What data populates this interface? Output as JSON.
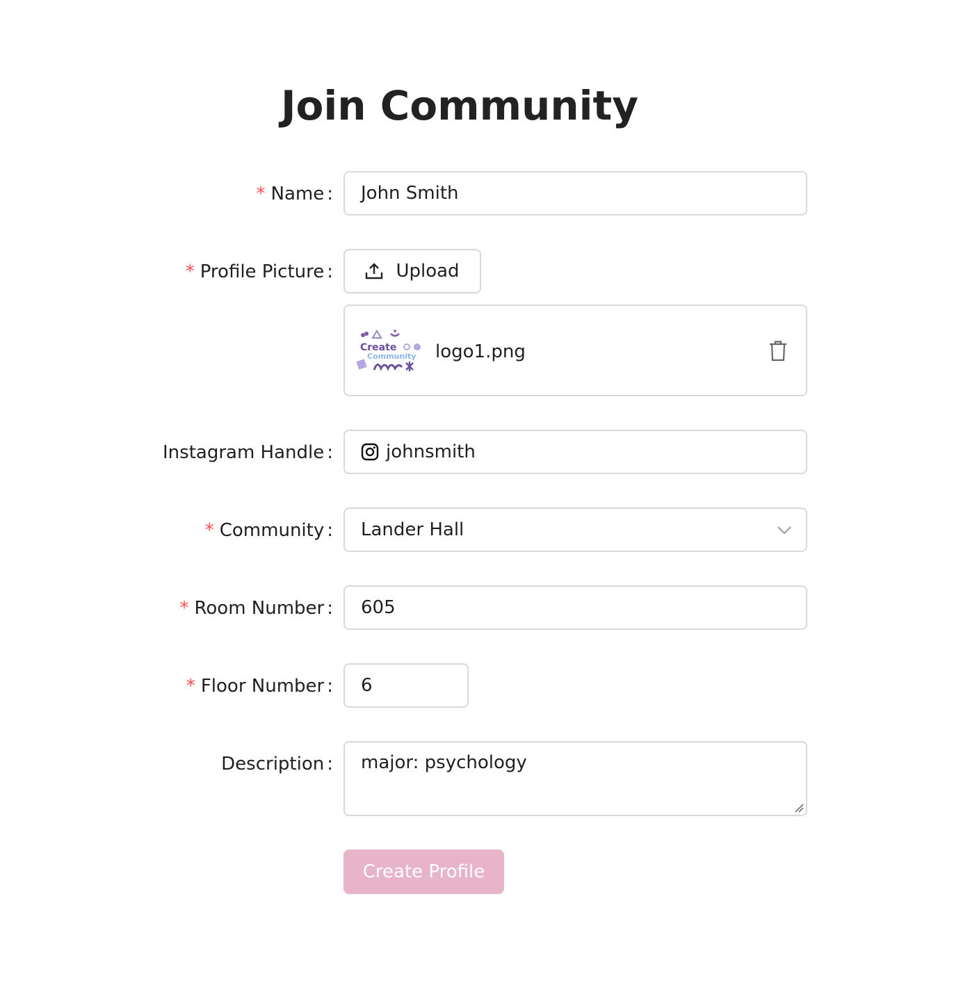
{
  "title": "Join Community",
  "fields": {
    "name": {
      "label": "Name",
      "value": "John Smith"
    },
    "profile_picture": {
      "label": "Profile Picture",
      "upload_label": "Upload",
      "file_name": "logo1.png",
      "thumb_text_1": "Create",
      "thumb_text_2": "Community"
    },
    "instagram": {
      "label": "Instagram Handle",
      "value": "johnsmith"
    },
    "community": {
      "label": "Community",
      "value": "Lander Hall"
    },
    "room_number": {
      "label": "Room Number",
      "value": "605"
    },
    "floor_number": {
      "label": "Floor Number",
      "value": "6"
    },
    "description": {
      "label": "Description",
      "value": "major: psychology"
    }
  },
  "submit_label": "Create Profile",
  "colors": {
    "required": "#ff4d4f",
    "submit_bg": "#e8b4c9",
    "border": "#d9d9d9"
  }
}
